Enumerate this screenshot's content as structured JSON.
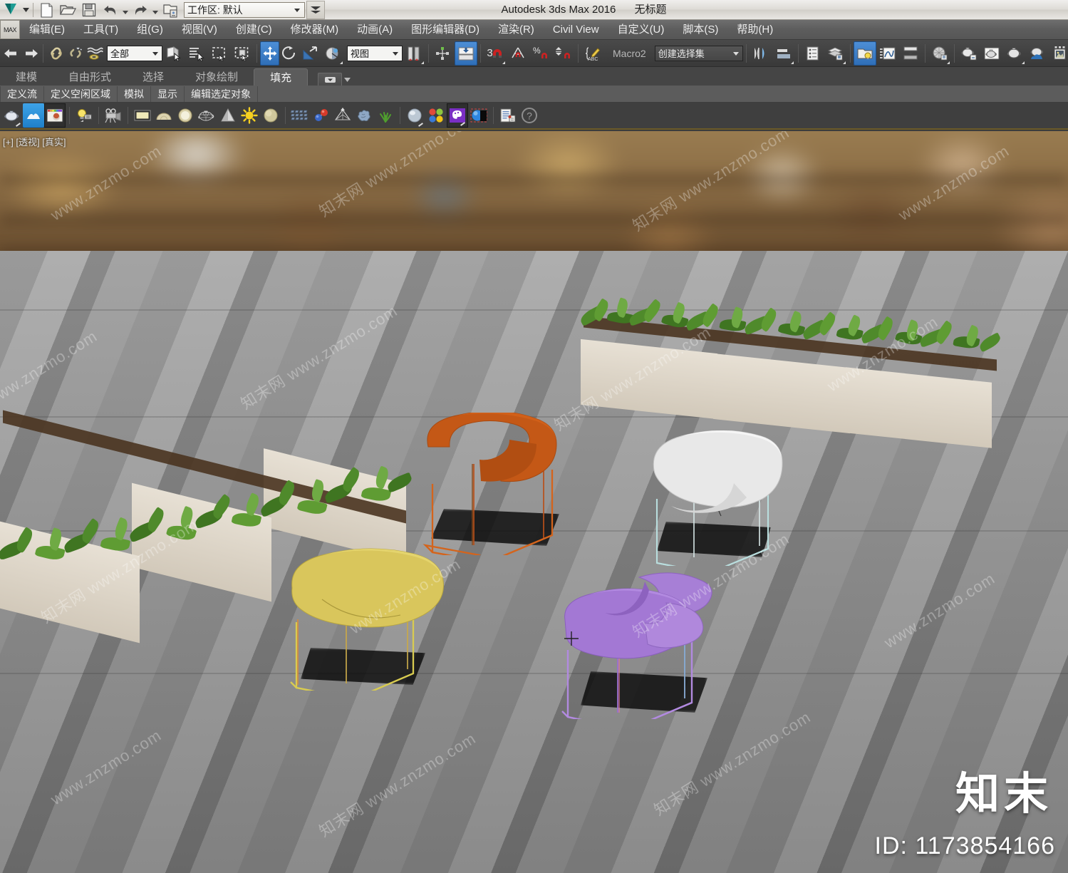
{
  "app": {
    "title": "Autodesk 3ds Max 2016",
    "document": "无标题",
    "logo_label": "MAX"
  },
  "quick_access": {
    "items": [
      {
        "name": "new-file-button",
        "icon": "new-file-icon",
        "tooltip": "新建"
      },
      {
        "name": "open-file-button",
        "icon": "open-folder-icon",
        "tooltip": "打开"
      },
      {
        "name": "save-file-button",
        "icon": "save-disk-icon",
        "tooltip": "保存"
      },
      {
        "name": "undo-button",
        "icon": "undo-arrow-icon",
        "tooltip": "撤消"
      },
      {
        "name": "redo-button",
        "icon": "redo-arrow-icon",
        "tooltip": "重做"
      },
      {
        "name": "project-folder-button",
        "icon": "project-folder-icon",
        "tooltip": "设置项目文件夹"
      }
    ],
    "workspace_label": "工作区: 默认"
  },
  "menu": {
    "items": [
      "编辑(E)",
      "工具(T)",
      "组(G)",
      "视图(V)",
      "创建(C)",
      "修改器(M)",
      "动画(A)",
      "图形编辑器(D)",
      "渲染(R)",
      "Civil View",
      "自定义(U)",
      "脚本(S)",
      "帮助(H)"
    ]
  },
  "toolbar": {
    "selection_filter": "全部",
    "reference_coord": "视图",
    "macro_label": "Macro2",
    "named_selection_set": "创建选择集",
    "buttons": [
      {
        "name": "undo-button",
        "icon": "undo-icon"
      },
      {
        "name": "redo-button",
        "icon": "redo-icon"
      },
      {
        "name": "select-and-link-button",
        "icon": "link-chain-icon"
      },
      {
        "name": "unlink-selection-button",
        "icon": "unlink-chain-icon"
      },
      {
        "name": "bind-to-space-warp-button",
        "icon": "space-warp-icon"
      },
      {
        "name": "select-object-button",
        "icon": "select-cursor-icon"
      },
      {
        "name": "select-by-name-button",
        "icon": "select-by-name-icon"
      },
      {
        "name": "rectangular-selection-region-button",
        "icon": "rect-marquee-icon"
      },
      {
        "name": "window-crossing-button",
        "icon": "window-crossing-icon"
      },
      {
        "name": "select-and-move-button",
        "icon": "move-gizmo-icon",
        "active": true
      },
      {
        "name": "select-and-rotate-button",
        "icon": "rotate-gizmo-icon"
      },
      {
        "name": "select-and-scale-button",
        "icon": "scale-gizmo-icon"
      },
      {
        "name": "use-center-flyout-button",
        "icon": "pivot-center-icon"
      },
      {
        "name": "mirror-button",
        "icon": "mirror-icon"
      },
      {
        "name": "align-button",
        "icon": "align-icon"
      },
      {
        "name": "snaps-toggle-button",
        "icon": "snap-magnet-3-icon",
        "count": "3"
      },
      {
        "name": "angle-snap-toggle-button",
        "icon": "angle-snap-icon"
      },
      {
        "name": "percent-snap-toggle-button",
        "icon": "percent-snap-icon"
      },
      {
        "name": "spinner-snap-toggle-button",
        "icon": "spinner-snap-icon"
      },
      {
        "name": "edit-named-selection-sets-button",
        "icon": "named-set-edit-icon"
      },
      {
        "name": "mirror-tool-button",
        "icon": "mirror-axis-icon"
      },
      {
        "name": "align-tool-button",
        "icon": "align-objects-icon"
      },
      {
        "name": "layer-explorer-button",
        "icon": "scene-explorer-icon"
      },
      {
        "name": "layer-manager-button",
        "icon": "layer-stack-icon"
      },
      {
        "name": "toggle-scene-explorer-button",
        "icon": "folder-bulb-icon",
        "active": true
      },
      {
        "name": "curve-editor-button",
        "icon": "curve-editor-icon"
      },
      {
        "name": "schematic-view-button",
        "icon": "schematic-view-icon"
      },
      {
        "name": "material-editor-button",
        "icon": "material-sphere-icon"
      },
      {
        "name": "render-setup-button",
        "icon": "teapot-setup-icon"
      },
      {
        "name": "rendered-frame-window-button",
        "icon": "teapot-frame-icon"
      },
      {
        "name": "render-production-button",
        "icon": "teapot-render-icon"
      },
      {
        "name": "render-iterative-button",
        "icon": "teapot-cloud-icon"
      },
      {
        "name": "render-in-cloud-button",
        "icon": "image-preview-icon"
      }
    ]
  },
  "ribbon": {
    "tabs": [
      {
        "label": "建模",
        "active": false
      },
      {
        "label": "自由形式",
        "active": false
      },
      {
        "label": "选择",
        "active": false
      },
      {
        "label": "对象绘制",
        "active": false
      },
      {
        "label": "填充",
        "active": true
      }
    ],
    "subtabs": [
      "定义流",
      "定义空闲区域",
      "模拟",
      "显示",
      "编辑选定对象"
    ],
    "icons": [
      {
        "name": "teapot-object-icon"
      },
      {
        "name": "populate-highlight-icon",
        "selected": true
      },
      {
        "name": "render-preview-icon",
        "framed": true
      },
      {
        "name": "light-bulb-icon"
      },
      {
        "name": "camera-icon"
      },
      {
        "name": "plane-primitive-icon"
      },
      {
        "name": "dome-primitive-icon"
      },
      {
        "name": "sphere-primitive-icon"
      },
      {
        "name": "teapot-wireframe-icon"
      },
      {
        "name": "cone-primitive-icon"
      },
      {
        "name": "sun-light-icon"
      },
      {
        "name": "sphere-shaded-icon"
      },
      {
        "name": "grid-array-icon"
      },
      {
        "name": "molecule-icon"
      },
      {
        "name": "pyramid-gizmo-icon"
      },
      {
        "name": "noise-cloud-icon"
      },
      {
        "name": "grass-foliage-icon"
      },
      {
        "name": "glass-sphere-icon"
      },
      {
        "name": "color-swatches-icon"
      },
      {
        "name": "material-palette-icon"
      },
      {
        "name": "sphere-alpha-icon"
      },
      {
        "name": "document-list-icon"
      },
      {
        "name": "help-question-icon"
      }
    ]
  },
  "viewport": {
    "label": "[+] [透视] [真实]",
    "view_type": "透视",
    "shading": "真实",
    "scene": {
      "backdrop": "blurred retail mall interior",
      "floor": "striped gray stone paving",
      "planters": [
        {
          "name": "planter-row-left",
          "segments": 3,
          "box_color": "#ded6c9",
          "soil_color": "#4a3420"
        },
        {
          "name": "planter-row-right",
          "segments": 3,
          "box_color": "#ded6c9",
          "soil_color": "#4a3420"
        }
      ],
      "objects": [
        {
          "name": "orange-lounge-chair",
          "color": "#c45816",
          "wire_color": "#d4641c"
        },
        {
          "name": "white-lounge-chair",
          "color": "#e8e8e8",
          "wire_color": "#b8e0e0"
        },
        {
          "name": "yellow-lounge-chair",
          "color": "#d9c65c",
          "wire_color": "#d9c65c"
        },
        {
          "name": "purple-lounge-chair",
          "color": "#a378d4",
          "wire_color": "#b28ae0"
        }
      ]
    }
  },
  "watermark": {
    "brand": "知末",
    "id": "ID: 1173854166",
    "tiles": [
      "www.znzmo.com",
      "知末网 www.znzmo.com",
      "www.znzmo.com",
      "知末网 www.znzmo.com",
      "www.znzmo.com",
      "知末网",
      "www.znzmo.com"
    ]
  }
}
